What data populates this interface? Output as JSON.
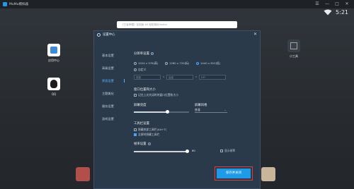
{
  "window": {
    "title": "MuMu模拟器"
  },
  "status": {
    "time": "5:21"
  },
  "search": {
    "placeholder": "《王者荣耀》定制版 64  轻松畅玩Switch"
  },
  "desktop": {
    "icons": [
      {
        "label": "应用中心"
      },
      {
        "label": "QQ"
      },
      {
        "label": "小工具"
      }
    ]
  },
  "dialog": {
    "title": "设置中心",
    "close_icon": "close-icon",
    "nav": [
      "基本设置",
      "高级设置",
      "界面设置",
      "主题美化",
      "服务设置",
      "游戏设置"
    ],
    "active_nav_index": 2,
    "content": {
      "resolution": {
        "label": "分辨率设置",
        "options": [
          "1024 x 576(高)",
          "1280 x 720(标)",
          "1440 x 810(低)"
        ],
        "custom_label": "自定义",
        "selected_index": 2,
        "custom_fields": [
          "宽度",
          "高度",
          "DPI"
        ]
      },
      "window_size": {
        "label": "窗口位置和大小",
        "checkbox_label": "记住上次关闭时的窗口位置和大小",
        "checked": false
      },
      "brightness": {
        "label": "屏幕亮度",
        "value": 0.6
      },
      "volume": {
        "label": "屏幕风格",
        "select_value": "普通"
      },
      "toolbar": {
        "label": "工具栏设置",
        "items": [
          {
            "label": "隐藏底部工具栏(Alt+T)",
            "checked": false
          },
          {
            "label": "全屏时隐藏工具栏",
            "checked": true
          }
        ]
      },
      "frame": {
        "label": "帧率设置",
        "value_text": "60",
        "value": 0.95,
        "checkbox_label": "显示帧率"
      }
    },
    "save_label": "保存并关闭"
  }
}
